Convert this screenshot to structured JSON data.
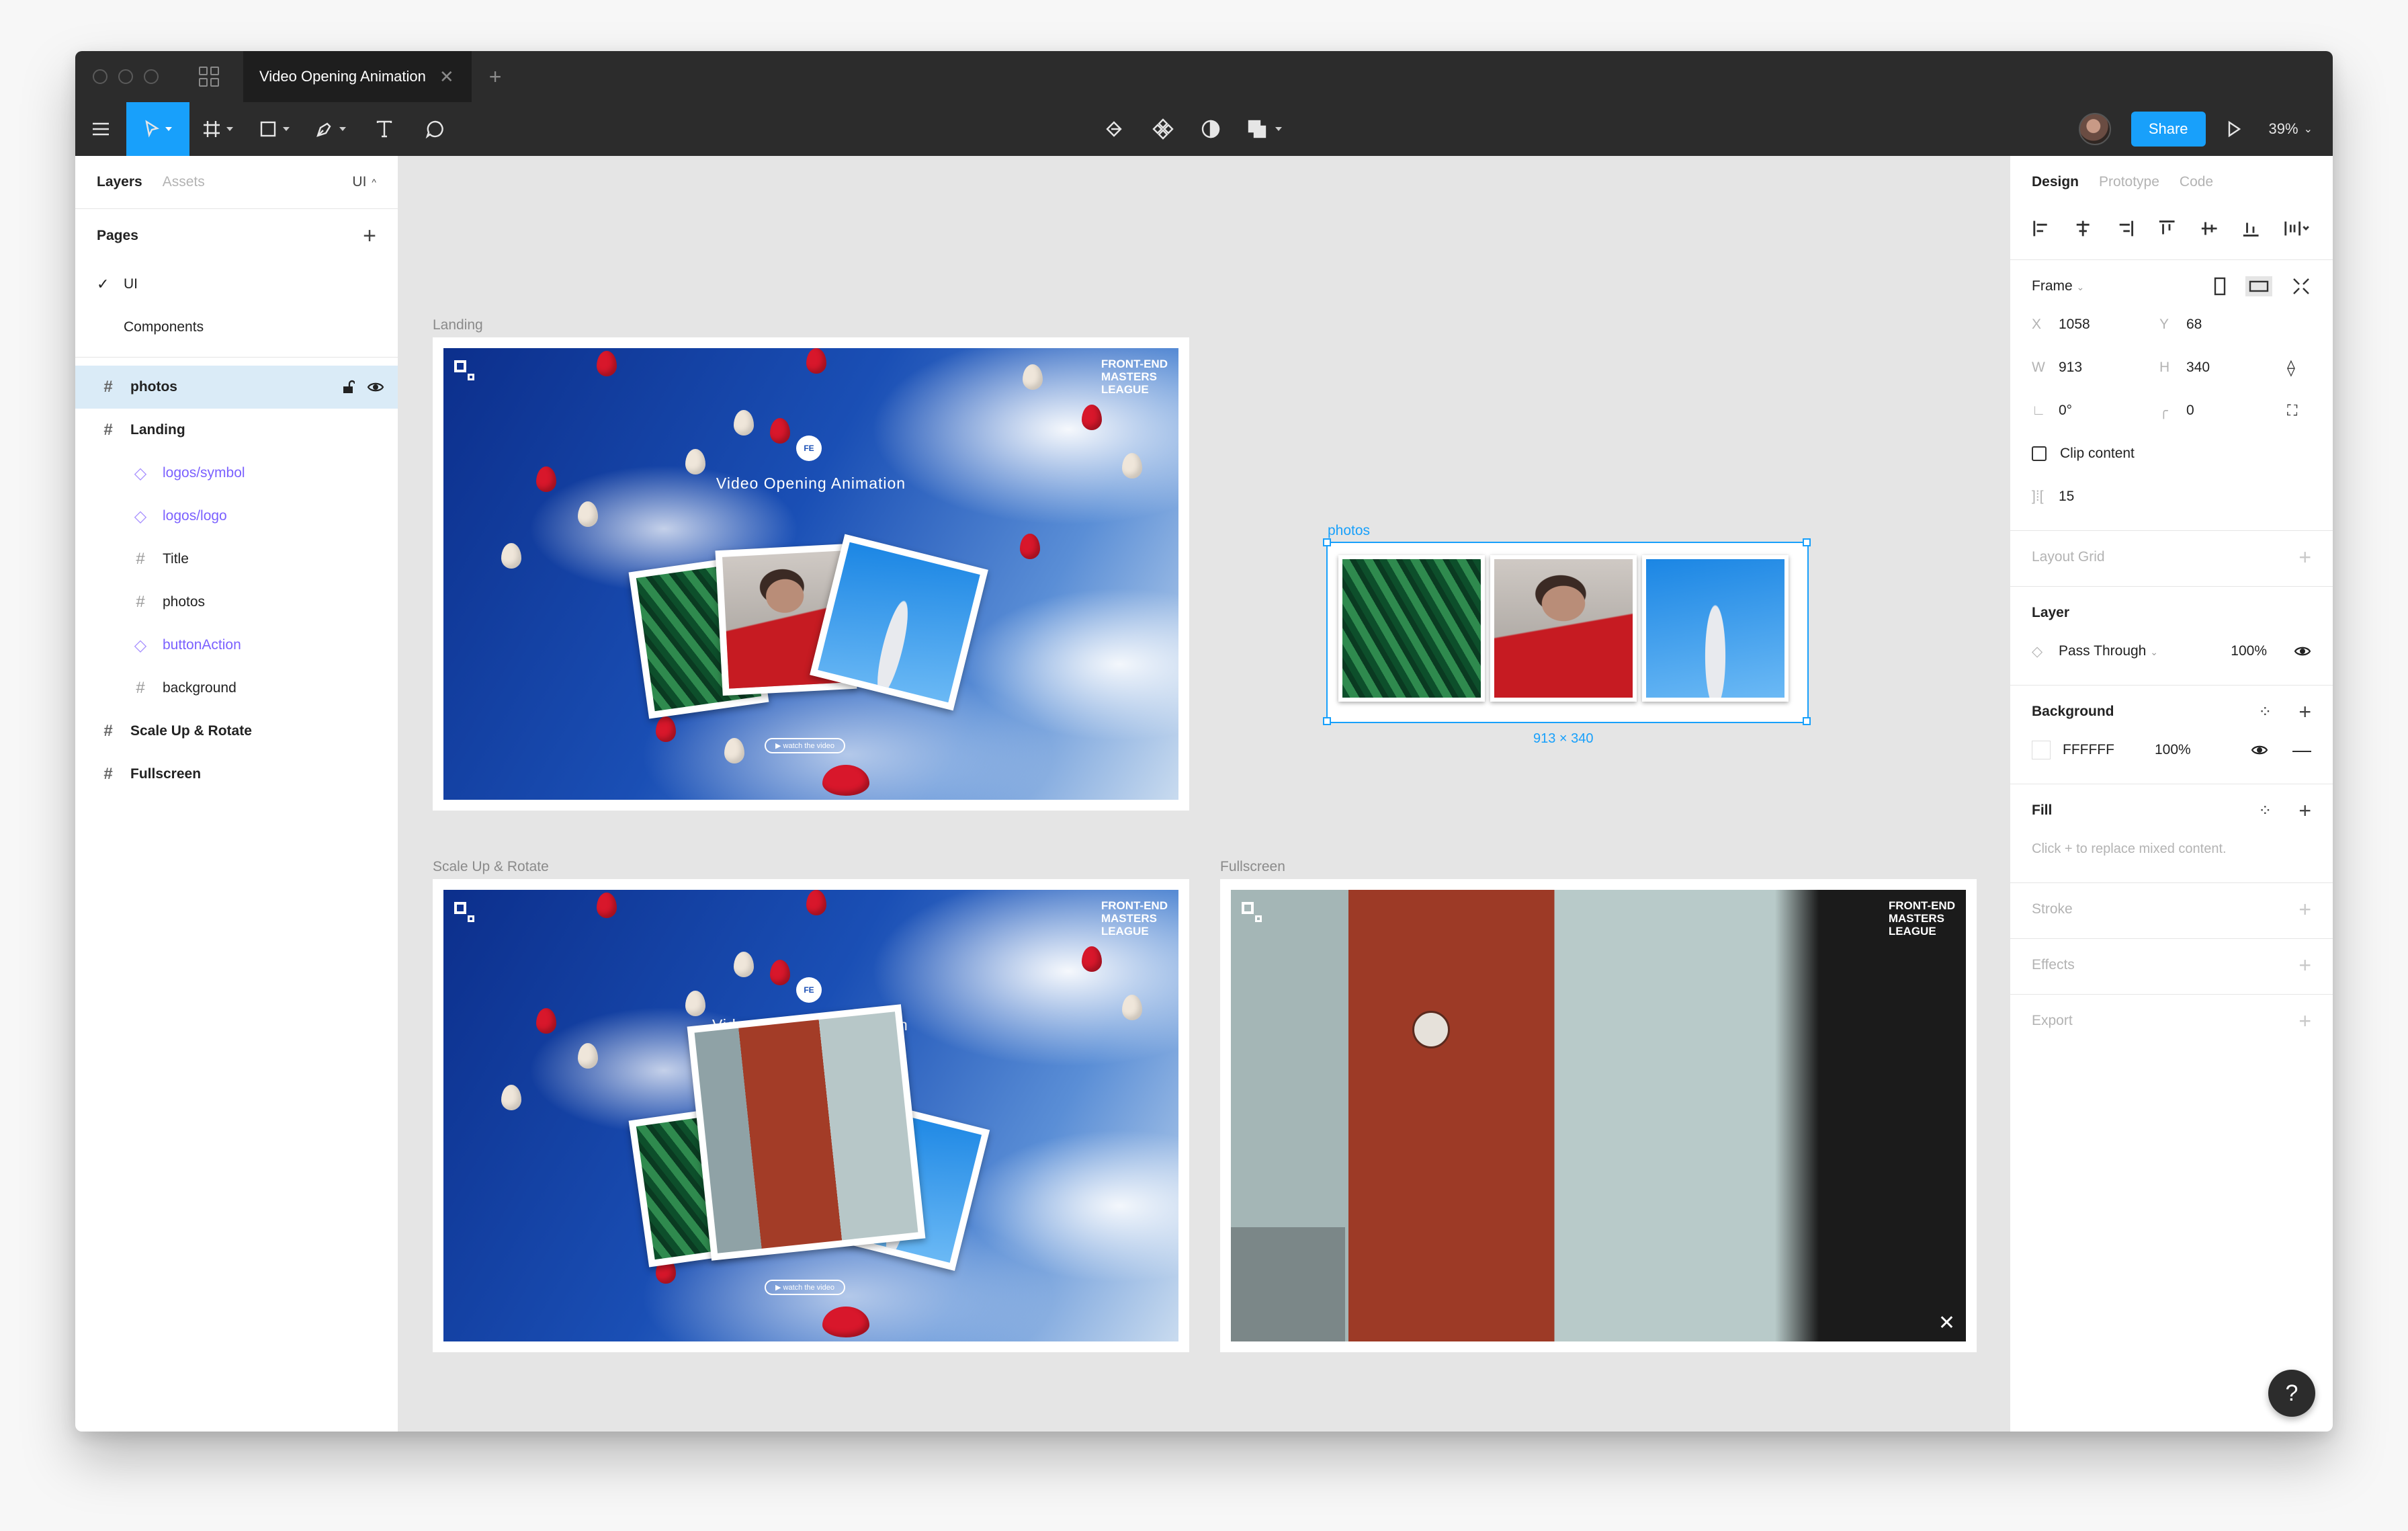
{
  "tab": {
    "title": "Video Opening Animation"
  },
  "toolbar": {
    "share": "Share",
    "zoom": "39%"
  },
  "left_panel": {
    "tabs": {
      "layers": "Layers",
      "assets": "Assets",
      "page": "UI"
    },
    "pages_title": "Pages",
    "pages": [
      {
        "label": "UI",
        "checked": true
      },
      {
        "label": "Components",
        "checked": false
      }
    ],
    "layers": [
      {
        "label": "photos",
        "icon": "frame-icon",
        "selected": true
      },
      {
        "label": "Landing",
        "icon": "frame-icon"
      },
      {
        "label": "logos/symbol",
        "icon": "instance-icon"
      },
      {
        "label": "logos/logo",
        "icon": "instance-icon"
      },
      {
        "label": "Title",
        "icon": "frame-icon"
      },
      {
        "label": "photos",
        "icon": "frame-icon"
      },
      {
        "label": "buttonAction",
        "icon": "instance-icon"
      },
      {
        "label": "background",
        "icon": "frame-icon"
      },
      {
        "label": "Scale Up & Rotate",
        "icon": "frame-icon"
      },
      {
        "label": "Fullscreen",
        "icon": "frame-icon"
      }
    ]
  },
  "canvas": {
    "frames": {
      "landing": "Landing",
      "scale": "Scale Up & Rotate",
      "fullscreen": "Fullscreen",
      "photos": "photos"
    },
    "brand": {
      "line1": "FRONT-END",
      "line2": "MASTERS",
      "line3": "LEAGUE"
    },
    "hero_title": "Video Opening Animation",
    "hero_title_partial_left": "Vid",
    "hero_title_partial_right": "n",
    "watch_button": "▶ watch the video",
    "round_logo": "FE",
    "selection_size": "913 × 340"
  },
  "right_panel": {
    "tabs": {
      "design": "Design",
      "prototype": "Prototype",
      "code": "Code"
    },
    "frame": {
      "label": "Frame",
      "x_label": "X",
      "x": "1058",
      "y_label": "Y",
      "y": "68",
      "w_label": "W",
      "w": "913",
      "h_label": "H",
      "h": "340",
      "rotation": "0°",
      "radius": "0",
      "clip": "Clip content",
      "spacing": "15"
    },
    "layout_grid": "Layout Grid",
    "layer": {
      "title": "Layer",
      "blend": "Pass Through",
      "opacity": "100%"
    },
    "background": {
      "title": "Background",
      "hex": "FFFFFF",
      "opacity": "100%"
    },
    "fill": {
      "title": "Fill",
      "hint": "Click + to replace mixed content."
    },
    "stroke": "Stroke",
    "effects": "Effects",
    "export": "Export"
  },
  "help": "?"
}
